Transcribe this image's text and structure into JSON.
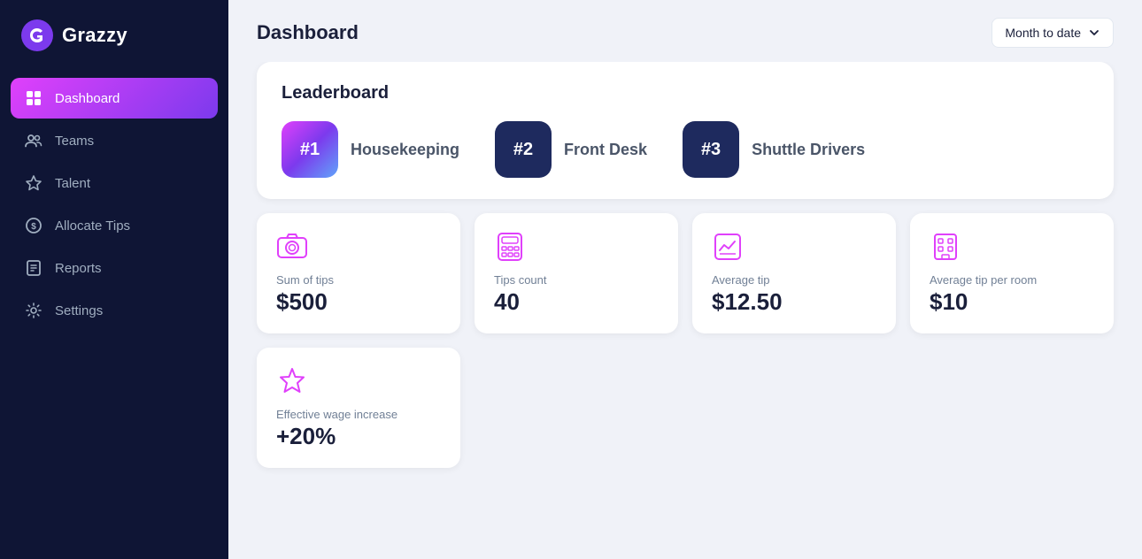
{
  "app": {
    "name": "Grazzy"
  },
  "sidebar": {
    "nav_items": [
      {
        "id": "dashboard",
        "label": "Dashboard",
        "active": true
      },
      {
        "id": "teams",
        "label": "Teams",
        "active": false
      },
      {
        "id": "talent",
        "label": "Talent",
        "active": false
      },
      {
        "id": "allocate-tips",
        "label": "Allocate Tips",
        "active": false
      },
      {
        "id": "reports",
        "label": "Reports",
        "active": false
      },
      {
        "id": "settings",
        "label": "Settings",
        "active": false
      }
    ]
  },
  "header": {
    "title": "Dashboard",
    "date_filter": "Month to date"
  },
  "leaderboard": {
    "title": "Leaderboard",
    "items": [
      {
        "rank": "#1",
        "name": "Housekeeping"
      },
      {
        "rank": "#2",
        "name": "Front Desk"
      },
      {
        "rank": "#3",
        "name": "Shuttle Drivers"
      }
    ]
  },
  "stats": [
    {
      "id": "sum-of-tips",
      "label": "Sum of tips",
      "value": "$500"
    },
    {
      "id": "tips-count",
      "label": "Tips count",
      "value": "40"
    },
    {
      "id": "average-tip",
      "label": "Average tip",
      "value": "$12.50"
    },
    {
      "id": "average-tip-per-room",
      "label": "Average tip per room",
      "value": "$10"
    }
  ],
  "bottom_stats": [
    {
      "id": "effective-wage-increase",
      "label": "Effective wage increase",
      "value": "+20%"
    }
  ]
}
